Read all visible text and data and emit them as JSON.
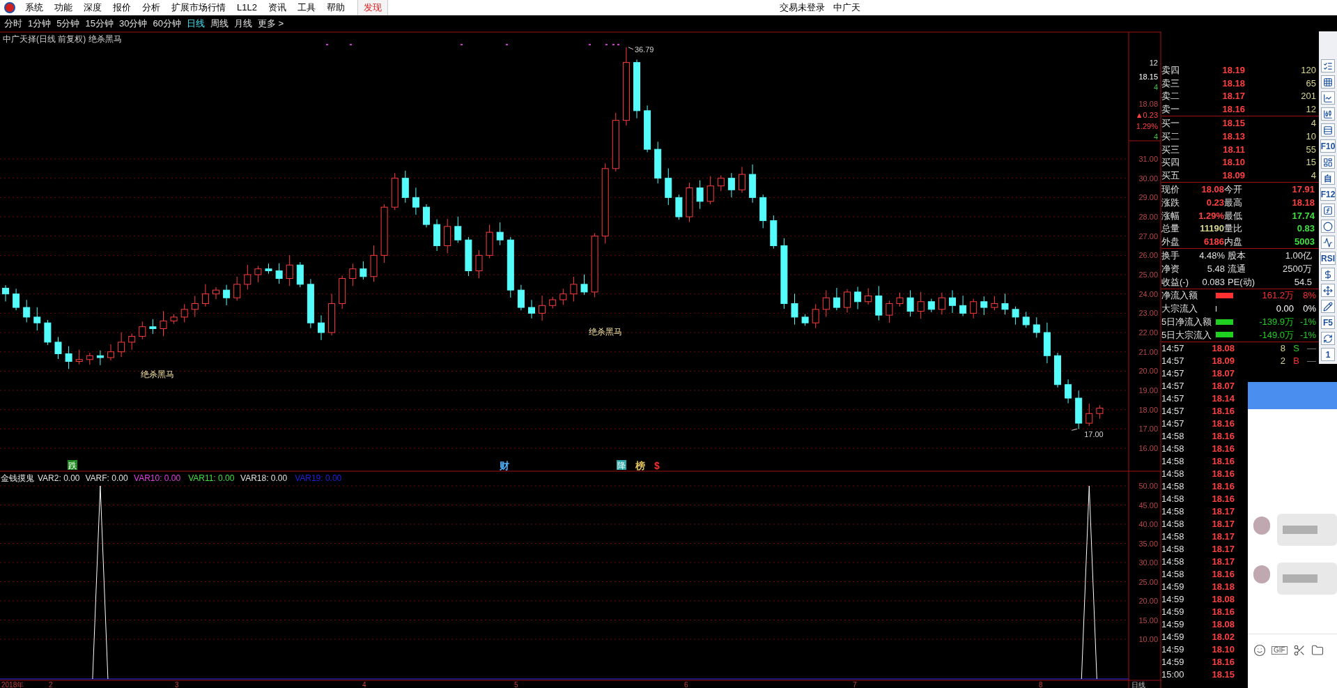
{
  "menu": {
    "items": [
      {
        "label": "系统",
        "selected": false
      },
      {
        "label": "功能",
        "selected": false
      },
      {
        "label": "深度",
        "selected": false
      },
      {
        "label": "报价",
        "selected": false
      },
      {
        "label": "分析",
        "selected": false
      },
      {
        "label": "扩展市场行情",
        "selected": false
      },
      {
        "label": "L1L2",
        "selected": false
      },
      {
        "label": "资讯",
        "selected": false
      },
      {
        "label": "工具",
        "selected": false
      },
      {
        "label": "帮助",
        "selected": false
      },
      {
        "label": "发现",
        "selected": true
      }
    ],
    "login": "交易未登录",
    "stock": "中广天"
  },
  "periods": [
    {
      "label": "分时",
      "selected": false
    },
    {
      "label": "1分钟",
      "selected": false
    },
    {
      "label": "5分钟",
      "selected": false
    },
    {
      "label": "15分钟",
      "selected": false
    },
    {
      "label": "30分钟",
      "selected": false
    },
    {
      "label": "60分钟",
      "selected": false
    },
    {
      "label": "日线",
      "selected": true
    },
    {
      "label": "周线",
      "selected": false
    },
    {
      "label": "月线",
      "selected": false
    },
    {
      "label": "更多 >",
      "selected": false
    }
  ],
  "chart": {
    "title": "中广天择(日线 前复权) 绝杀黑马",
    "high_label": "36.79",
    "low_label": "17.00",
    "signals": [
      "绝杀黑马",
      "绝杀黑马"
    ],
    "events": [
      {
        "text": "跌",
        "kind": "boxed",
        "color": "#1e8c1e"
      },
      {
        "text": "财",
        "kind": "plain",
        "color": "#4fb4ff"
      },
      {
        "text": "降",
        "kind": "boxed",
        "color": "#2aa8a8"
      },
      {
        "text": "榜",
        "kind": "plain",
        "color": "#e0c060"
      },
      {
        "text": "$",
        "kind": "plain",
        "color": "#ff3030"
      }
    ],
    "price_ticks": [
      "31.00",
      "30.00",
      "29.00",
      "28.00",
      "27.00",
      "26.00",
      "25.00",
      "24.00",
      "23.00",
      "22.00",
      "21.00",
      "20.00",
      "19.00",
      "18.00",
      "17.00",
      "16.00"
    ],
    "mini_quote": [
      "12",
      "18.15",
      "4",
      "18.08",
      "▲0.23",
      "1.29%",
      "4"
    ],
    "dates": [
      "2018年",
      "2",
      "3",
      "4",
      "5",
      "6",
      "7",
      "8"
    ],
    "period_label": "日线"
  },
  "indicator": {
    "name": "金钱摸鬼",
    "vars": [
      {
        "label": "VAR2: 0.00",
        "color": "#e0e0e0"
      },
      {
        "label": "VARF: 0.00",
        "color": "#e0e0e0"
      },
      {
        "label": "VAR10: 0.00",
        "color": "#e040e0"
      },
      {
        "label": "VAR11: 0.00",
        "color": "#40e040"
      },
      {
        "label": "VAR18: 0.00",
        "color": "#e0e0e0"
      },
      {
        "label": "VAR19: 0.00",
        "color": "#2020e0"
      }
    ],
    "ticks": [
      "50.00",
      "45.00",
      "40.00",
      "35.00",
      "30.00",
      "25.00",
      "20.00",
      "15.00",
      "10.00"
    ]
  },
  "order_book": {
    "asks": [
      {
        "label": "卖四",
        "price": "18.19",
        "volume": "120"
      },
      {
        "label": "卖三",
        "price": "18.18",
        "volume": "65"
      },
      {
        "label": "卖二",
        "price": "18.17",
        "volume": "201"
      },
      {
        "label": "卖一",
        "price": "18.16",
        "volume": "12"
      }
    ],
    "bids": [
      {
        "label": "买一",
        "price": "18.15",
        "volume": "4"
      },
      {
        "label": "买二",
        "price": "18.13",
        "volume": "10"
      },
      {
        "label": "买三",
        "price": "18.11",
        "volume": "55"
      },
      {
        "label": "买四",
        "price": "18.10",
        "volume": "15"
      },
      {
        "label": "买五",
        "price": "18.09",
        "volume": "4"
      }
    ]
  },
  "quote": [
    {
      "label": "现价",
      "value": "18.08",
      "color": "#ff4040"
    },
    {
      "label": "今开",
      "value": "17.91",
      "color": "#ff4040"
    },
    {
      "label": "涨跌",
      "value": "0.23",
      "color": "#ff4040"
    },
    {
      "label": "最高",
      "value": "18.18",
      "color": "#ff4040"
    },
    {
      "label": "涨幅",
      "value": "1.29%",
      "color": "#ff4040"
    },
    {
      "label": "最低",
      "value": "17.74",
      "color": "#40e040"
    },
    {
      "label": "总量",
      "value": "11190",
      "color": "#d8d890"
    },
    {
      "label": "量比",
      "value": "0.83",
      "color": "#40e040"
    },
    {
      "label": "外盘",
      "value": "6186",
      "color": "#ff4040"
    },
    {
      "label": "内盘",
      "value": "5003",
      "color": "#40e040"
    }
  ],
  "fundamentals": [
    {
      "label": "换手",
      "value": "4.48%"
    },
    {
      "label": "股本",
      "value": "1.00亿"
    },
    {
      "label": "净资",
      "value": "5.48"
    },
    {
      "label": "流通",
      "value": "2500万"
    },
    {
      "label": "收益(-)",
      "value": "0.083"
    },
    {
      "label": "PE(动)",
      "value": "54.5"
    }
  ],
  "flows": [
    {
      "label": "净流入额",
      "amount": "161.2万",
      "pct": "8%",
      "color": "#ff3030",
      "kind": "bar"
    },
    {
      "label": "大宗流入",
      "amount": "0.00",
      "pct": "0%",
      "color": "#ffffff",
      "kind": "tick"
    },
    {
      "label": "5日净流入额",
      "amount": "-139.9万",
      "pct": "-1%",
      "color": "#20d020",
      "kind": "bar"
    },
    {
      "label": "5日大宗流入",
      "amount": "-149.0万",
      "pct": "-1%",
      "color": "#20d020",
      "kind": "bar"
    }
  ],
  "trades": [
    {
      "time": "14:57",
      "price": "18.08",
      "volume": "8",
      "side": "S",
      "kind": "sell",
      "flag": "—"
    },
    {
      "time": "14:57",
      "price": "18.09",
      "volume": "2",
      "side": "B",
      "kind": "buy",
      "flag": "—"
    },
    {
      "time": "14:57",
      "price": "18.07"
    },
    {
      "time": "14:57",
      "price": "18.07"
    },
    {
      "time": "14:57",
      "price": "18.14"
    },
    {
      "time": "14:57",
      "price": "18.16"
    },
    {
      "time": "14:57",
      "price": "18.16"
    },
    {
      "time": "14:58",
      "price": "18.16"
    },
    {
      "time": "14:58",
      "price": "18.16"
    },
    {
      "time": "14:58",
      "price": "18.16"
    },
    {
      "time": "14:58",
      "price": "18.16"
    },
    {
      "time": "14:58",
      "price": "18.16"
    },
    {
      "time": "14:58",
      "price": "18.16"
    },
    {
      "time": "14:58",
      "price": "18.17"
    },
    {
      "time": "14:58",
      "price": "18.17"
    },
    {
      "time": "14:58",
      "price": "18.17"
    },
    {
      "time": "14:58",
      "price": "18.17"
    },
    {
      "time": "14:58",
      "price": "18.17"
    },
    {
      "time": "14:58",
      "price": "18.16"
    },
    {
      "time": "14:59",
      "price": "18.18"
    },
    {
      "time": "14:59",
      "price": "18.08"
    },
    {
      "time": "14:59",
      "price": "18.16"
    },
    {
      "time": "14:59",
      "price": "18.08"
    },
    {
      "time": "14:59",
      "price": "18.02"
    },
    {
      "time": "14:59",
      "price": "18.10"
    },
    {
      "time": "14:59",
      "price": "18.16"
    },
    {
      "time": "15:00",
      "price": "18.15"
    }
  ],
  "toolbar": [
    {
      "kind": "icon"
    },
    {
      "kind": "icon"
    },
    {
      "kind": "icon"
    },
    {
      "kind": "icon"
    },
    {
      "kind": "icon"
    },
    {
      "kind": "label",
      "label": "F10"
    },
    {
      "kind": "icon"
    },
    {
      "kind": "label",
      "label": "自"
    },
    {
      "kind": "label",
      "label": "F12"
    },
    {
      "kind": "icon"
    },
    {
      "kind": "icon"
    },
    {
      "kind": "icon"
    },
    {
      "kind": "label",
      "label": "RSI"
    },
    {
      "kind": "icon"
    },
    {
      "kind": "icon"
    },
    {
      "kind": "icon"
    },
    {
      "kind": "label",
      "label": "F5"
    },
    {
      "kind": "icon"
    },
    {
      "kind": "label",
      "label": "1"
    }
  ],
  "chat": {
    "messages": [
      {
        "kind": "blurred"
      },
      {
        "kind": "blurred"
      }
    ],
    "tools": [
      {
        "kind": "smile"
      },
      {
        "kind": "gif",
        "label": "GIF"
      },
      {
        "kind": "scissors"
      },
      {
        "kind": "folder"
      }
    ]
  }
}
